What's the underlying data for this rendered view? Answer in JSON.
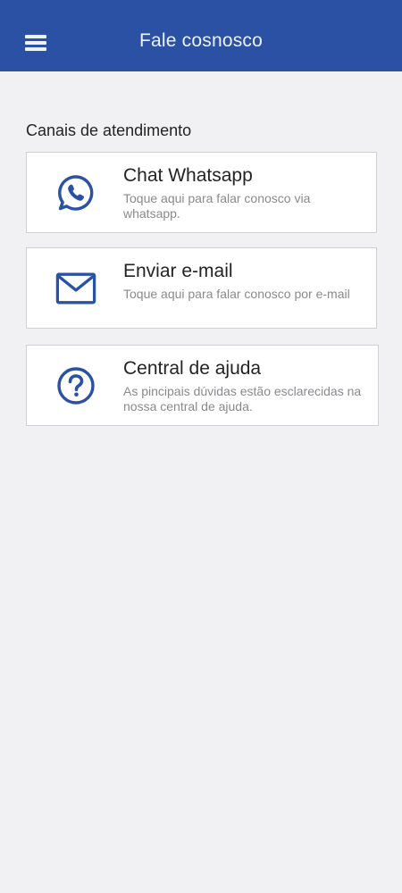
{
  "header": {
    "title": "Fale cosnosco",
    "menu_icon": "menu-icon",
    "background": "#2a51a3"
  },
  "section": {
    "title": "Canais de atendimento"
  },
  "channels": [
    {
      "title": "Chat Whatsapp",
      "description": "Toque aqui para falar conosco via whatsapp.",
      "icon": "whatsapp-icon"
    },
    {
      "title": "Enviar e-mail",
      "description": "Toque aqui para falar conosco por e-mail",
      "icon": "mail-icon"
    },
    {
      "title": "Central de ajuda",
      "description": "As pincipais dúvidas estão esclarecidas na nossa central de ajuda.",
      "icon": "help-icon"
    }
  ],
  "colors": {
    "accent": "#2a51a3",
    "background": "#f1f1f3",
    "card": "#ffffff",
    "text": "#232323",
    "muted": "#8a8a8e"
  }
}
